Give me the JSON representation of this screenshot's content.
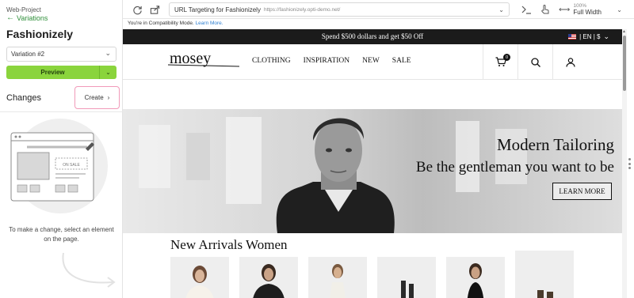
{
  "sidebar": {
    "project": "Web-Project",
    "back_label": "Variations",
    "experiment_title": "Fashionizely",
    "variation_select": "Variation #2",
    "preview_label": "Preview",
    "changes_label": "Changes",
    "create_label": "Create",
    "illustration_badge": "ON SALE",
    "hint": "To make a change, select an element on the page."
  },
  "toolbar": {
    "url_title": "URL Targeting for Fashionizely",
    "url_value": "https://fashionizely.opti-demo.net/",
    "width_percent": "100%",
    "width_mode": "Full Width"
  },
  "compat": {
    "text": "You're in Compatibility Mode.",
    "link": "Learn More."
  },
  "site": {
    "promo": "Spend $500 dollars and get $50 Off",
    "lang": "| EN | $",
    "logo": "mosey",
    "menu": [
      "CLOTHING",
      "INSPIRATION",
      "NEW",
      "SALE"
    ],
    "cart_count": "0",
    "hero_title": "Modern Tailoring",
    "hero_subtitle": "Be the gentleman you want to be",
    "hero_button": "LEARN MORE",
    "section_title": "New Arrivals Women"
  },
  "icons": [
    "arrow-left-icon",
    "chevron-down-icon",
    "chevron-right-icon",
    "refresh-icon",
    "share-icon",
    "terminal-icon",
    "touch-icon",
    "resize-icon",
    "cart-icon",
    "search-icon",
    "user-icon",
    "flag-us-icon"
  ],
  "colors": {
    "accent_green": "#8ad43c",
    "link_green": "#2f8f3a",
    "create_border": "#f19ab9",
    "promo_bg": "#1b1b1b"
  }
}
